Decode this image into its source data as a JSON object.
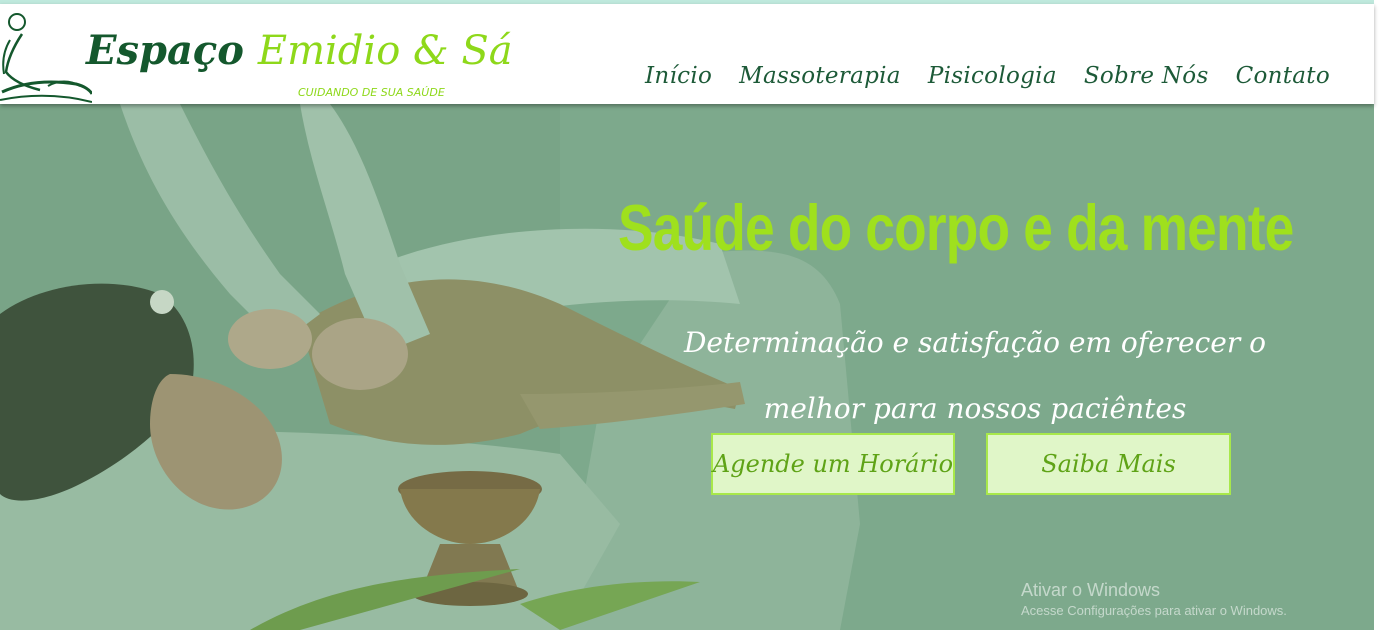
{
  "header": {
    "brand_part1": "Espaço",
    "brand_part2": "Emidio & Sá",
    "tagline": "CUIDANDO DE SUA SAÚDE",
    "nav": [
      "Início",
      "Massoterapia",
      "Pisicologia",
      "Sobre Nós",
      "Contato"
    ]
  },
  "hero": {
    "title": "Saúde do corpo e da mente",
    "subtitle_line1": "Determinação e satisfação em oferecer o",
    "subtitle_line2": "melhor para nossos paciêntes",
    "button_schedule": "Agende um Horário",
    "button_more": "Saiba Mais"
  },
  "watermark": {
    "line1": "Ativar o Windows",
    "line2": "Acesse Configurações para ativar o Windows."
  },
  "colors": {
    "brand_dark_green": "#14582d",
    "brand_lime": "#8ed81a",
    "hero_overlay": "#86ad93",
    "button_bg": "#e0f6c8"
  },
  "icons": [
    "massage-logo-icon"
  ]
}
